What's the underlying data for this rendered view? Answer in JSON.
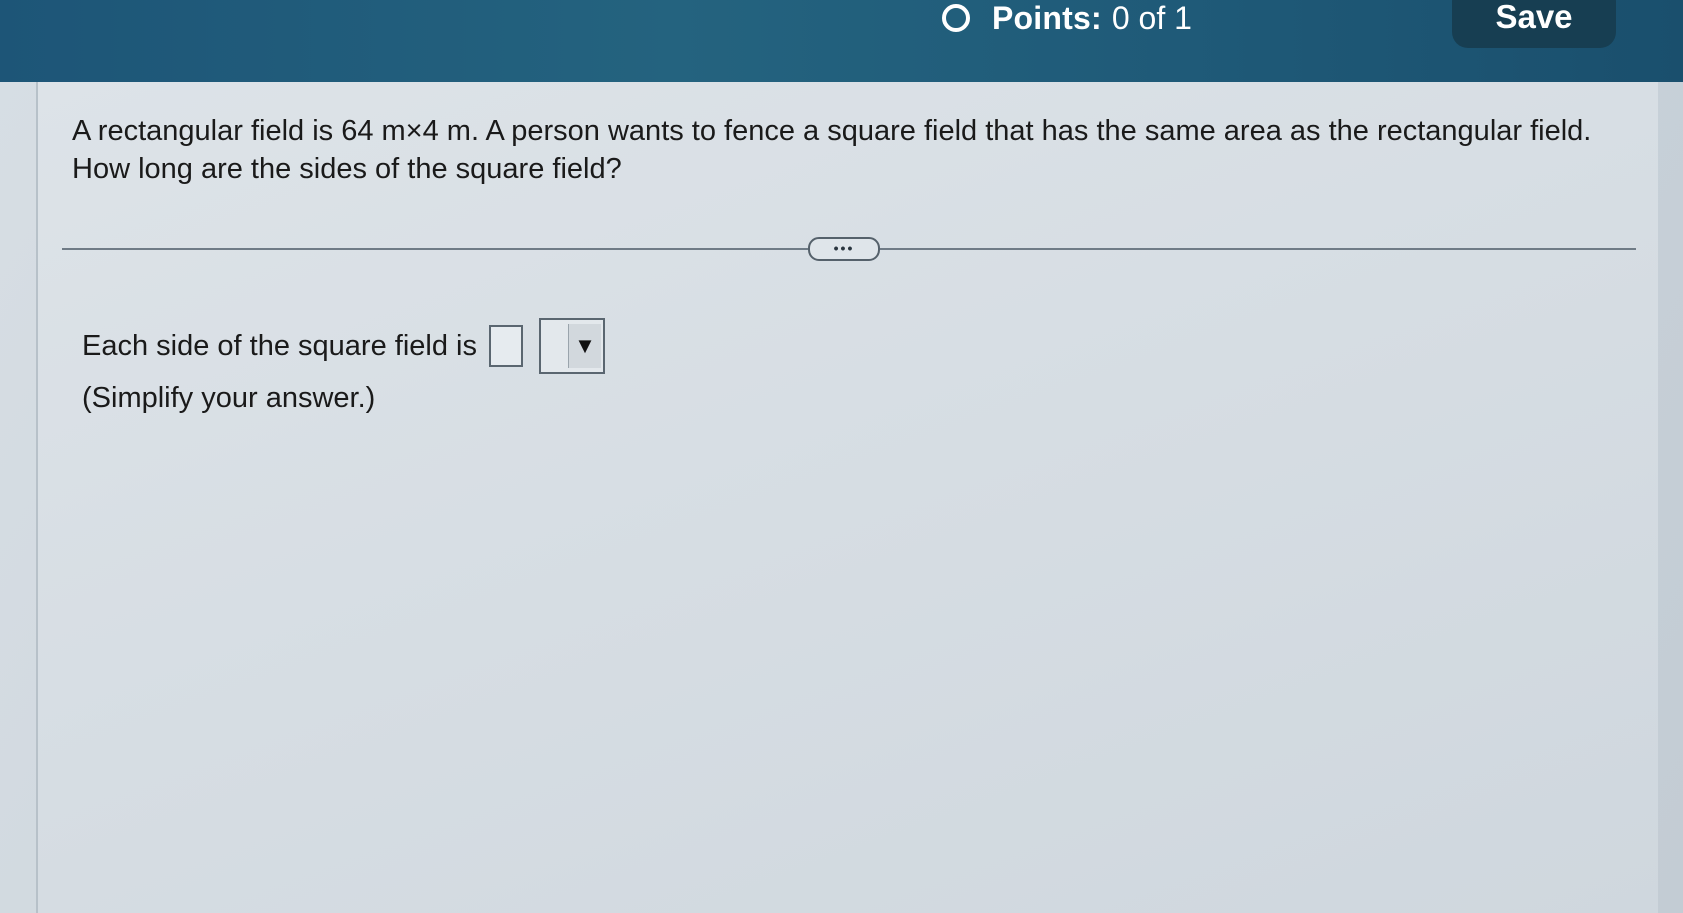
{
  "header": {
    "points_label": "Points:",
    "points_value": "0 of 1",
    "save_label": "Save"
  },
  "question": {
    "text": "A rectangular field is 64 m×4 m. A person wants to fence a square field that has the same area as the rectangular field. How long are the sides of the square field?"
  },
  "more_button": {
    "label": "•••"
  },
  "answer": {
    "prompt": "Each side of the square field is",
    "input_value": "",
    "unit_selected": "",
    "hint": "(Simplify your answer.)"
  },
  "icons": {
    "status": "circle-outline-icon",
    "dropdown": "triangle-down-icon"
  },
  "colors": {
    "header_bg": "#1f5a78",
    "save_bg": "#173e52",
    "page_bg": "#d6dde3"
  }
}
